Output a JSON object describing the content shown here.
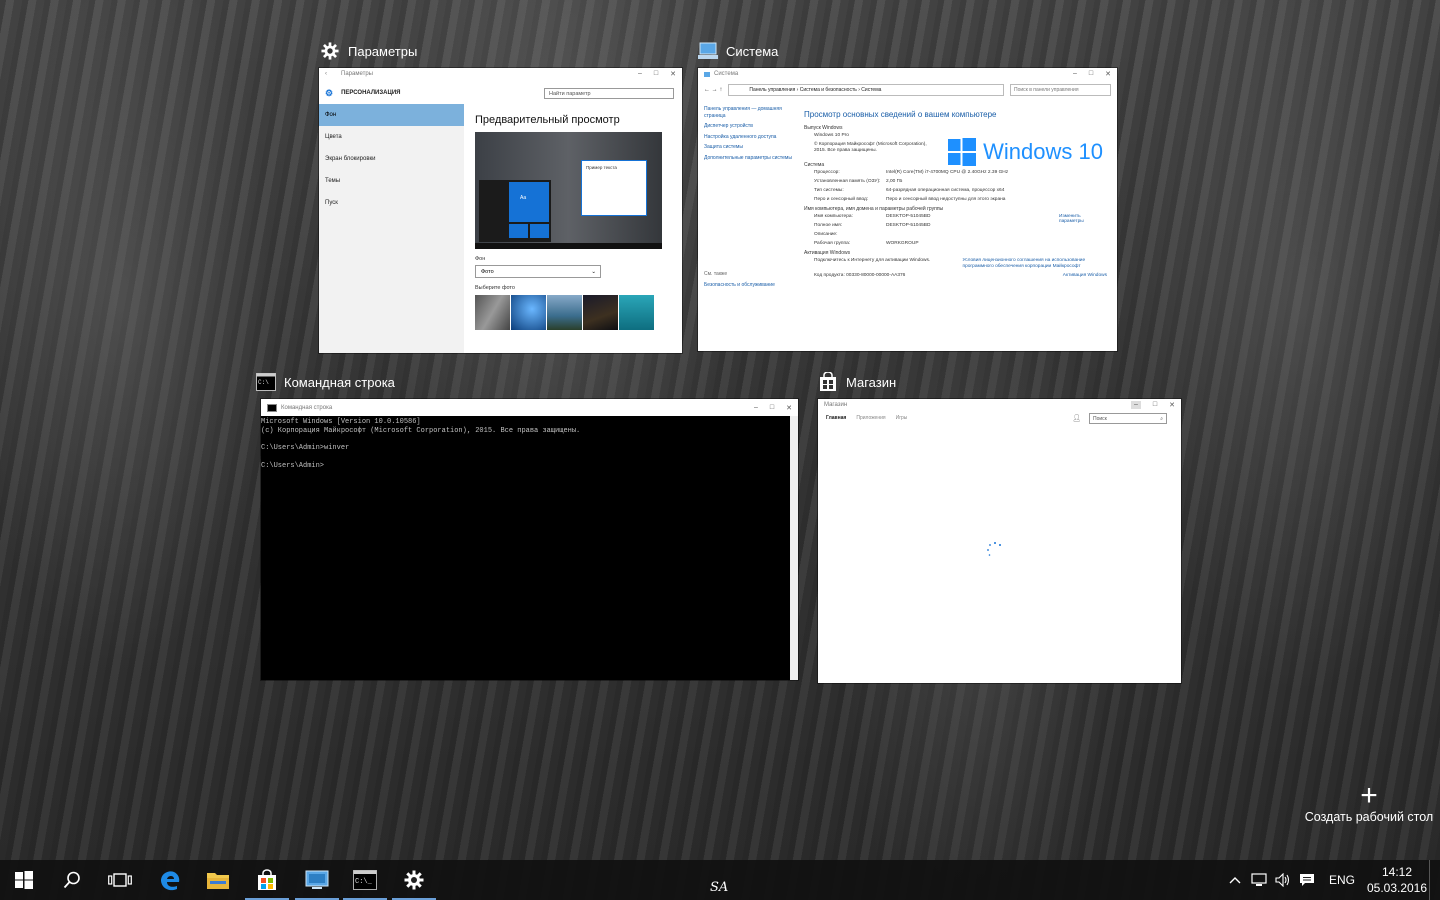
{
  "task_view": {
    "windows": [
      {
        "title": "Параметры",
        "icon": "gear-icon"
      },
      {
        "title": "Система",
        "icon": "system-computer-icon"
      },
      {
        "title": "Командная строка",
        "icon": "cmd-icon"
      },
      {
        "title": "Магазин",
        "icon": "store-icon"
      }
    ],
    "add_desktop_label": "Создать рабочий стол"
  },
  "settings": {
    "window_title": "Параметры",
    "section": "ПЕРСОНАЛИЗАЦИЯ",
    "search_placeholder": "Найти параметр",
    "nav": [
      "Фон",
      "Цвета",
      "Экран блокировки",
      "Темы",
      "Пуск"
    ],
    "preview_title": "Предварительный просмотр",
    "sample_text": "Пример текста",
    "tile_label": "Aa",
    "bg_label": "Фон",
    "bg_value": "Фото",
    "choose_photo": "Выберите фото"
  },
  "system": {
    "window_title": "Система",
    "breadcrumb": "Панель управления  ›  Система и безопасность  ›  Система",
    "search_placeholder": "Поиск в панели управления",
    "left_links": [
      "Панель управления — домашняя страница",
      "Диспетчер устройств",
      "Настройка удаленного доступа",
      "Защита системы",
      "Дополнительные параметры системы"
    ],
    "see_also": "См. также",
    "see_also_link": "Безопасность и обслуживание",
    "heading": "Просмотр основных сведений о вашем компьютере",
    "edition_section": "Выпуск Windows",
    "edition": "Windows 10 Pro",
    "copyright": "© Корпорация Майкрософт (Microsoft Corporation), 2015. Все права защищены.",
    "logo_text": "Windows 10",
    "system_section": "Система",
    "specs": [
      {
        "k": "Процессор:",
        "v": "Intel(R) Core(TM) i7-4700MQ CPU @ 2.40GHz   2.39 GHz"
      },
      {
        "k": "Установленная память (ОЗУ):",
        "v": "2,00 ГБ"
      },
      {
        "k": "Тип системы:",
        "v": "64-разрядная операционная система, процессор x64"
      },
      {
        "k": "Перо и сенсорный ввод:",
        "v": "Перо и сенсорный ввод недоступны для этого экрана"
      }
    ],
    "name_section": "Имя компьютера, имя домена и параметры рабочей группы",
    "names": [
      {
        "k": "Имя компьютера:",
        "v": "DESKTOP-51045BD"
      },
      {
        "k": "Полное имя:",
        "v": "DESKTOP-51045BD"
      },
      {
        "k": "Описание:",
        "v": ""
      },
      {
        "k": "Рабочая группа:",
        "v": "WORKGROUP"
      }
    ],
    "change_link": "Изменить параметры",
    "activation_section": "Активация Windows",
    "activation_text": "Подключитесь к Интернету для активации Windows.",
    "license_link": "Условия лицензионного соглашения на использование программного обеспечения корпорации Майкрософт",
    "product_code": "Код продукта: 00330-80000-00000-AA376",
    "activate_link": "Активация Windows"
  },
  "cmd": {
    "window_title": "Командная строка",
    "output": "Microsoft Windows [Version 10.0.10586]\n(c) Корпорация Майкрософт (Microsoft Corporation), 2015. Все права защищены.\n\nC:\\Users\\Admin>winver\n\nC:\\Users\\Admin>"
  },
  "store": {
    "window_title": "Магазин",
    "tabs": [
      "Главная",
      "Приложения",
      "Игры"
    ],
    "search_placeholder": "Поиск"
  },
  "taskbar": {
    "apps": [
      "start-icon",
      "search-icon",
      "task-view-icon",
      "edge-icon",
      "file-explorer-icon",
      "store-icon",
      "system-icon",
      "cmd-icon",
      "settings-icon"
    ],
    "language": "ENG",
    "time": "14:12",
    "date": "05.03.2016",
    "watermark": "SA"
  },
  "colors": {
    "accent": "#1572d6",
    "link": "#1a5ea8",
    "taskbar_indicator": "#6a9fd8"
  }
}
